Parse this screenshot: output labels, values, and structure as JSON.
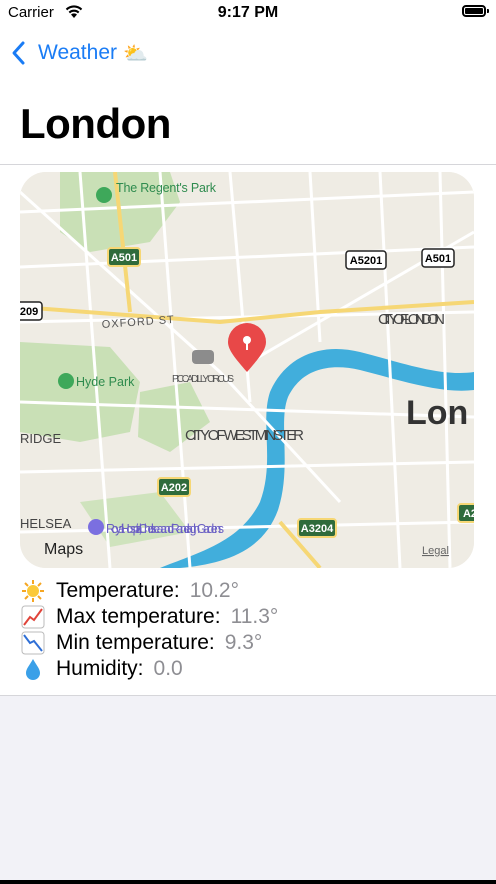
{
  "status_bar": {
    "carrier": "Carrier",
    "time": "9:17 PM"
  },
  "nav": {
    "back_label": "Weather",
    "back_emoji": "⛅",
    "title": "London"
  },
  "map": {
    "labels": {
      "regents_park": "The Regent's Park",
      "hyde_park": "Hyde Park",
      "oxford_st": "OXFORD ST",
      "piccadilly": "PICCADILLY CIRCUS",
      "westminster": "CITY OF WESTMINSTER",
      "city_of_london": "CITY OF LONDON",
      "london_partial": "Lon",
      "ridge": "RIDGE",
      "chelsea": "HELSEA",
      "royal_hospital": "Royal Hospital, Chelsea and Ranelagh Gardens",
      "maps_logo": "Maps",
      "legal": "Legal"
    },
    "roads": [
      "A501",
      "A5201",
      "A501",
      "209",
      "A202",
      "A3204",
      "A2"
    ]
  },
  "weather": [
    {
      "icon": "sun-icon",
      "label": "Temperature:",
      "value": "10.2°"
    },
    {
      "icon": "chart-up-icon",
      "label": "Max temperature:",
      "value": "11.3°"
    },
    {
      "icon": "chart-down-icon",
      "label": "Min temperature:",
      "value": "9.3°"
    },
    {
      "icon": "droplet-icon",
      "label": "Humidity:",
      "value": "0.0"
    }
  ],
  "colors": {
    "accent": "#1a7cf5",
    "pin": "#e84848",
    "river": "#41aedc",
    "park": "#b9d7a6"
  }
}
